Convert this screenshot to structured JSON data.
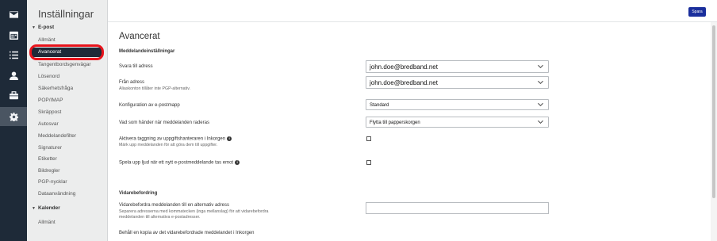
{
  "rail": {
    "icons": [
      "mail-icon",
      "calendar-icon",
      "list-icon",
      "contact-icon",
      "briefcase-icon",
      "gear-icon"
    ]
  },
  "sidebar": {
    "title": "Inställningar",
    "sections": [
      {
        "label": "E-post",
        "items": [
          "Allmänt",
          "Avancerat",
          "Tangentbordsgenvägar",
          "Lösenord",
          "Säkerhetsfråga",
          "POP/IMAP",
          "Skräppost",
          "Autosvar",
          "Meddelandefilter",
          "Signaturer",
          "Etiketter",
          "Bildregler",
          "PGP-nycklar",
          "Dataanvändning"
        ]
      },
      {
        "label": "Kalender",
        "items": [
          "Allmänt"
        ]
      }
    ],
    "active_item": "Avancerat"
  },
  "toolbar": {
    "save_label": "Spara"
  },
  "main": {
    "title": "Avancerat",
    "message_settings_heading": "Meddelandeinställningar",
    "reply_to": {
      "label": "Svara till adress",
      "value": "john.doe@bredband.net"
    },
    "from": {
      "label": "Från adress",
      "hint": "Aliaskonton tillåter inte PGP-alternativ.",
      "value": "john.doe@bredband.net"
    },
    "email_config": {
      "label": "Konfiguration av e-postmapp",
      "value": "Standard"
    },
    "on_delete": {
      "label": "Vad som händer när meddelanden raderas",
      "value": "Flytta till papperskorgen"
    },
    "task_tagging": {
      "label": "Aktivera taggning av uppgiftshanteraren i Inkorgen",
      "hint": "Märk upp meddelanden för att göra dem till uppgifter.",
      "checked": false
    },
    "sound": {
      "label": "Spela upp ljud när ett nytt e-postmeddelande tas emot",
      "checked": false
    },
    "forwarding_heading": "Vidarebefordring",
    "forward_alt": {
      "label": "Vidarebefordra meddelanden till en alternativ adress",
      "hint_line1": "Separera adresserna med kommatecken (inga mellanslag) för att vidarebefordra",
      "hint_line2": "meddelanden till alternativa e-postadresser.",
      "value": ""
    },
    "keep_copy": {
      "label": "Behåll en kopia av det vidarebefordrade meddelandet i Inkorgen"
    }
  },
  "colors": {
    "rail": "#1e2a38",
    "accent": "#1a2e9c",
    "highlight": "#e8141c"
  }
}
